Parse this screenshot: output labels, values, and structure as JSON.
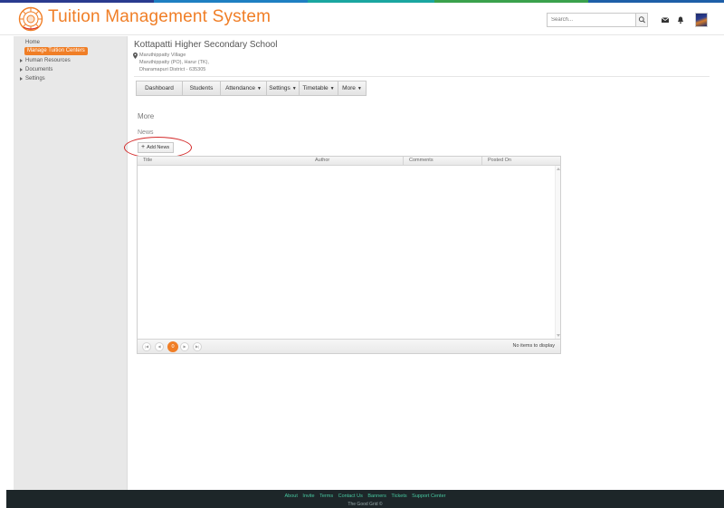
{
  "app": {
    "title": "Tuition Management System",
    "accent_color": "#f07e26",
    "logo_icon": "sun-emblem-logo"
  },
  "header": {
    "search_placeholder": "Search...",
    "icons": [
      "search-icon",
      "mail-icon",
      "bell-icon",
      "user-avatar"
    ]
  },
  "sidebar": {
    "home": "Home",
    "active_item": "Manage Tuition  Centers",
    "items": [
      {
        "label": "Human Resources",
        "expandable": true
      },
      {
        "label": "Documents",
        "expandable": true
      },
      {
        "label": "Settings",
        "expandable": true
      }
    ]
  },
  "school": {
    "name": "Kottapatti Higher Secondary School",
    "address_line1": "Maruthippatty Village",
    "address_line2": "Maruthippatty (PO), Harur (TK),",
    "address_line3": "Dharamapuri District - 635305"
  },
  "tabs": [
    {
      "label": "Dashboard",
      "dropdown": false
    },
    {
      "label": "Students",
      "dropdown": false
    },
    {
      "label": "Attendance",
      "dropdown": true
    },
    {
      "label": "Settings",
      "dropdown": true
    },
    {
      "label": "Timetable",
      "dropdown": true
    },
    {
      "label": "More",
      "dropdown": true
    }
  ],
  "content": {
    "section_title": "More",
    "sub_title": "News",
    "add_button": "Add News"
  },
  "grid": {
    "columns": [
      "Title",
      "Author",
      "Comments",
      "Posted On"
    ],
    "rows": [],
    "pager": {
      "current_page": "0",
      "empty_message": "No items to display"
    }
  },
  "footer": {
    "links": [
      "About",
      "Invite",
      "Terms",
      "Contact Us",
      "Banners",
      "Tickets",
      "Support Center"
    ],
    "copyright": "The Good Grid ©"
  }
}
